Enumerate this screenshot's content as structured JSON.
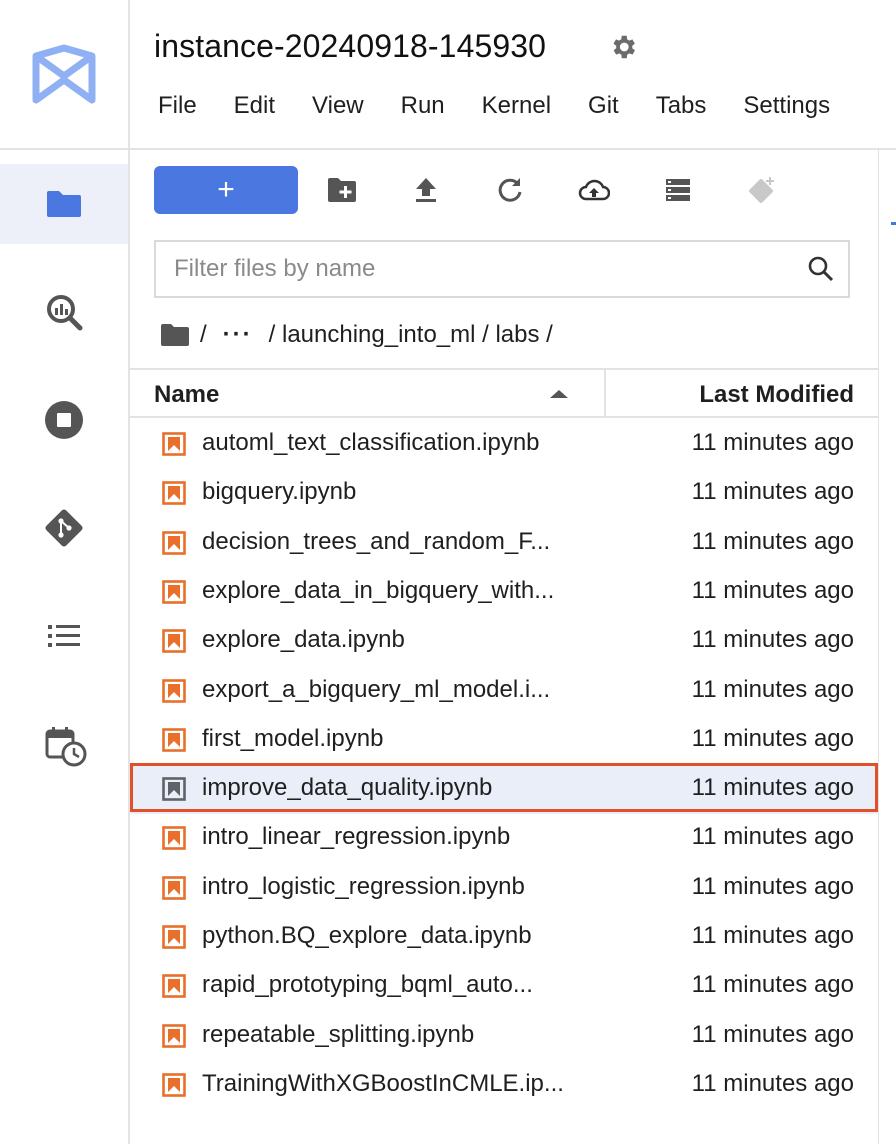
{
  "header": {
    "title": "instance-20240918-145930",
    "settings_icon": "gear-icon",
    "menu": [
      "File",
      "Edit",
      "View",
      "Run",
      "Kernel",
      "Git",
      "Tabs",
      "Settings"
    ]
  },
  "activity_bar": {
    "items": [
      {
        "icon": "folder-icon",
        "active": true
      },
      {
        "icon": "bigquery-search-icon",
        "active": false
      },
      {
        "icon": "stop-circle-icon",
        "active": false
      },
      {
        "icon": "git-icon",
        "active": false
      },
      {
        "icon": "list-icon",
        "active": false
      },
      {
        "icon": "calendar-clock-icon",
        "active": false
      }
    ]
  },
  "toolbar": {
    "new_label": "+",
    "buttons": [
      "new-folder-icon",
      "upload-icon",
      "refresh-icon",
      "cloud-upload-icon",
      "storage-icon",
      "git-clone-icon"
    ]
  },
  "filter": {
    "placeholder": "Filter files by name",
    "value": ""
  },
  "breadcrumb": {
    "root_sep": "/",
    "ellipsis": "···",
    "path": "/ launching_into_ml / labs /"
  },
  "list": {
    "col_name": "Name",
    "col_modified": "Last Modified",
    "files": [
      {
        "name": "automl_text_classification.ipynb",
        "modified": "11 minutes ago",
        "selected": false
      },
      {
        "name": "bigquery.ipynb",
        "modified": "11 minutes ago",
        "selected": false
      },
      {
        "name": "decision_trees_and_random_F...",
        "modified": "11 minutes ago",
        "selected": false
      },
      {
        "name": "explore_data_in_bigquery_with...",
        "modified": "11 minutes ago",
        "selected": false
      },
      {
        "name": "explore_data.ipynb",
        "modified": "11 minutes ago",
        "selected": false
      },
      {
        "name": "export_a_bigquery_ml_model.i...",
        "modified": "11 minutes ago",
        "selected": false
      },
      {
        "name": "first_model.ipynb",
        "modified": "11 minutes ago",
        "selected": false
      },
      {
        "name": "improve_data_quality.ipynb",
        "modified": "11 minutes ago",
        "selected": true
      },
      {
        "name": "intro_linear_regression.ipynb",
        "modified": "11 minutes ago",
        "selected": false
      },
      {
        "name": "intro_logistic_regression.ipynb",
        "modified": "11 minutes ago",
        "selected": false
      },
      {
        "name": "python.BQ_explore_data.ipynb",
        "modified": "11 minutes ago",
        "selected": false
      },
      {
        "name": "rapid_prototyping_bqml_auto...",
        "modified": "11 minutes ago",
        "selected": false
      },
      {
        "name": "repeatable_splitting.ipynb",
        "modified": "11 minutes ago",
        "selected": false
      },
      {
        "name": "TrainingWithXGBoostInCMLE.ip...",
        "modified": "11 minutes ago",
        "selected": false
      }
    ]
  },
  "colors": {
    "accent": "#4a78e0",
    "notebook_icon": "#e8702a",
    "selection_border": "#e2502a",
    "selection_bg": "#eaeef9"
  }
}
